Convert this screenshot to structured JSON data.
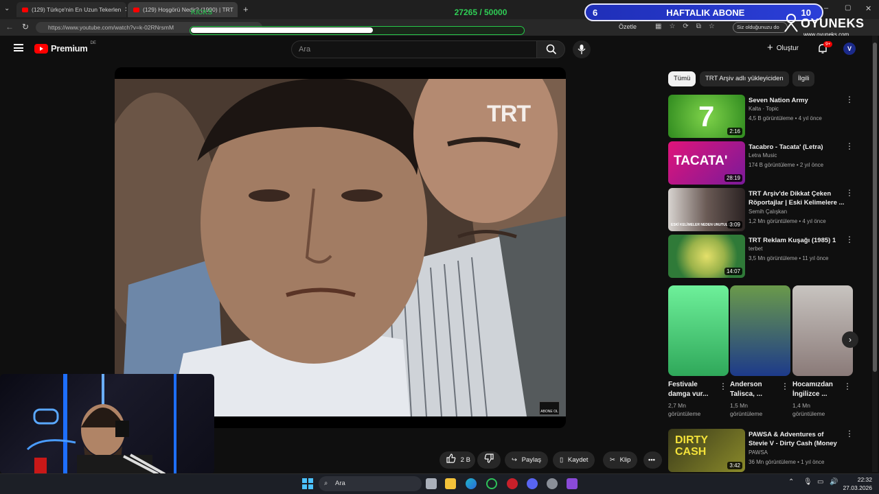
{
  "browser": {
    "tabs": [
      {
        "label": "(129) Türkçe'nin En Uzun Tekerlen"
      },
      {
        "label": "(129) Hoşgörü Nedir? (1990) | TRT"
      }
    ],
    "url": "https://www.youtube.com/watch?v=k-02RNrsmM",
    "summarize_label": "Özetle",
    "prompt_pill": "Siz olduğunuzu do"
  },
  "overlay": {
    "kicks_label": "KICKS",
    "sub_counter": "27265 / 50000",
    "sub_progress": 0.545,
    "weekly_left": "6",
    "weekly_label": "HAFTALIK ABONE",
    "weekly_right": "10",
    "brand": "OYUNEKS",
    "brand_url": "www.oyuneks.com"
  },
  "youtube": {
    "logo": "Premium",
    "logo_sup": "DE",
    "search_placeholder": "Ara",
    "create_label": "Oluştur",
    "notif_badge": "9+",
    "chips": [
      "Tümü",
      "TRT Arşiv adlı yükleyiciden",
      "İlgili"
    ],
    "recommendations": [
      {
        "title": "Seven Nation Army",
        "channel": "Kalta · Topic",
        "meta": "4,5 B görüntüleme • 4 yıl önce",
        "duration": "2:16",
        "thumb_text": "7"
      },
      {
        "title": "Tacabro - Tacata' (Letra)",
        "channel": "Letra Music",
        "meta": "174 B görüntüleme • 2 yıl önce",
        "duration": "28:19",
        "thumb_text": "TACATA'"
      },
      {
        "title": "TRT Arşiv'de Dikkat Çeken Röportajlar | Eski Kelimelere ...",
        "channel": "Semih Çalışkan",
        "meta": "1,2 Mn görüntüleme • 4 yıl önce",
        "duration": "3:09",
        "thumb_text": "ESKİ KELİMELER NEDEN UNUTULDU?"
      },
      {
        "title": "TRT Reklam Kuşağı (1985) 1",
        "channel": "terbet",
        "meta": "3,5 Mn görüntüleme • 11 yıl önce",
        "duration": "14:07",
        "thumb_text": ""
      }
    ],
    "shorts": [
      {
        "title": "Festivale damga vur...",
        "views": "2,7 Mn",
        "views_label": "görüntüleme"
      },
      {
        "title": "Anderson Talisca, ...",
        "views": "1,5 Mn",
        "views_label": "görüntüleme"
      },
      {
        "title": "Hocamızdan İngilizce ...",
        "views": "1,4 Mn",
        "views_label": "görüntüleme"
      }
    ],
    "rec_bottom": {
      "title": "PAWSA & Adventures of Stevie V - Dirty Cash (Money Talks)",
      "channel": "PAWSA",
      "meta": "36 Mn görüntüleme • 1 yıl önce",
      "duration": "3:42",
      "thumb_text": "DIRTY CASH"
    },
    "video": {
      "watermark": "TRT",
      "corner_label": "ABONE OL"
    },
    "actions": {
      "likes": "2 B",
      "share": "Paylaş",
      "save": "Kaydet",
      "clip": "Klip"
    }
  },
  "taskbar": {
    "search": "Ara",
    "time": "22:32",
    "date": "27.03.2026"
  },
  "colors": {
    "youtube_red": "#ff0000",
    "progress_green": "#2fce55",
    "weekly_blue": "#2233c8"
  }
}
